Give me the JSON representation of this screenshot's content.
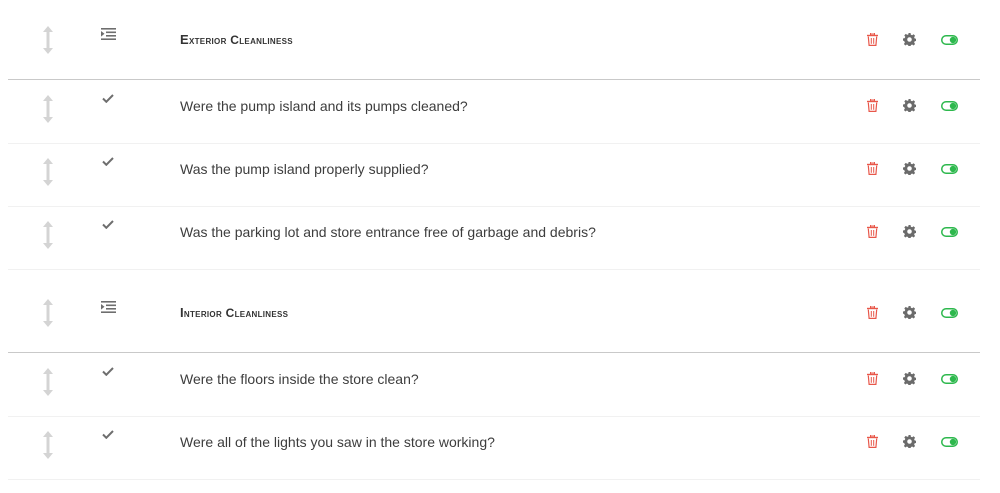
{
  "colors": {
    "delete": "#e8574a",
    "settings": "#6b6b6b",
    "toggle_on": "#2db84d",
    "drag": "#d4d4d4",
    "type_icon": "#6e6e6e",
    "section_divider": "#c9c9c9"
  },
  "rows": [
    {
      "kind": "section",
      "text": "Exterior Cleanliness",
      "type_icon": "indent-list-icon",
      "enabled": true
    },
    {
      "kind": "item",
      "text": "Were the pump island and its pumps cleaned?",
      "type_icon": "checkmark-icon",
      "enabled": true
    },
    {
      "kind": "item",
      "text": "Was the pump island properly supplied?",
      "type_icon": "checkmark-icon",
      "enabled": true
    },
    {
      "kind": "item",
      "text": "Was the parking lot and store entrance free of garbage and debris?",
      "type_icon": "checkmark-icon",
      "enabled": true
    },
    {
      "kind": "section",
      "text": "Interior Cleanliness",
      "type_icon": "indent-list-icon",
      "enabled": true
    },
    {
      "kind": "item",
      "text": "Were the floors inside the store clean?",
      "type_icon": "checkmark-icon",
      "enabled": true
    },
    {
      "kind": "item",
      "text": "Were all of the lights you saw in the store working?",
      "type_icon": "checkmark-icon",
      "enabled": true
    }
  ]
}
